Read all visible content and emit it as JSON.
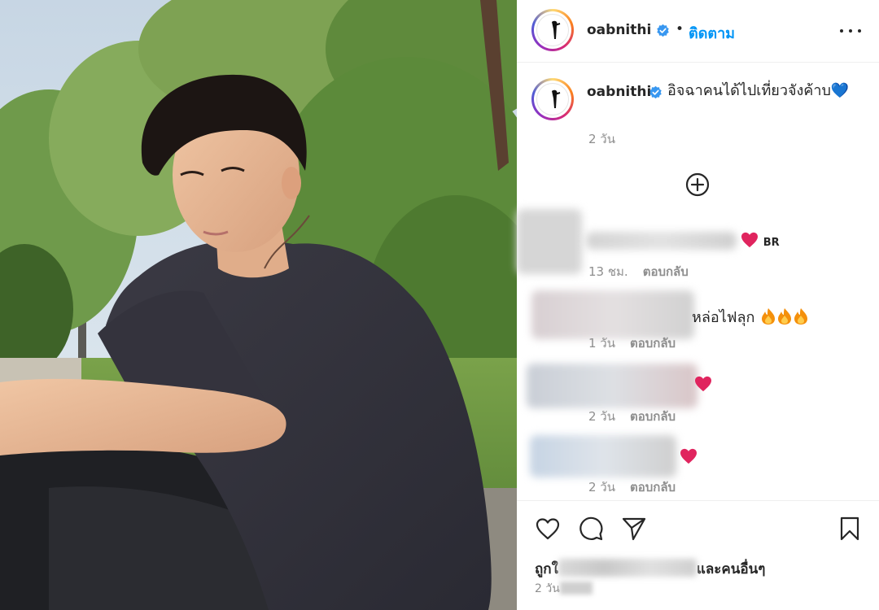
{
  "post": {
    "username": "oabnithi",
    "separator": "•",
    "follow_label": "ติดตาม",
    "more_icon": "more-horizontal-icon"
  },
  "caption": {
    "username": "oabnithi",
    "text": "อิจฉาคนได้ไปเที่ยวจังค้าบ💙",
    "time": "2 วัน"
  },
  "add_comments_icon": "plus-circle-icon",
  "comments": [
    {
      "text": "BR",
      "time": "13 ชม.",
      "reply": "ตอบกลับ"
    },
    {
      "text": "หล่อไฟลุก",
      "time": "1 วัน",
      "reply": "ตอบกลับ"
    },
    {
      "text": "",
      "time": "2 วัน",
      "reply": "ตอบกลับ"
    },
    {
      "text": "",
      "time": "2 วัน",
      "reply": "ตอบกลับ"
    }
  ],
  "actions": {
    "like_icon": "heart-icon",
    "comment_icon": "comment-icon",
    "share_icon": "send-icon",
    "save_icon": "bookmark-icon"
  },
  "likes": {
    "prefix": "ถูกใ",
    "suffix": "และคนอื่นๆ"
  },
  "post_date": {
    "text": "2 วัน"
  },
  "colors": {
    "link_blue": "#0095f6",
    "verified_blue": "#3897f0",
    "heart_red": "#ed4956",
    "muted": "#8e8e8e"
  }
}
